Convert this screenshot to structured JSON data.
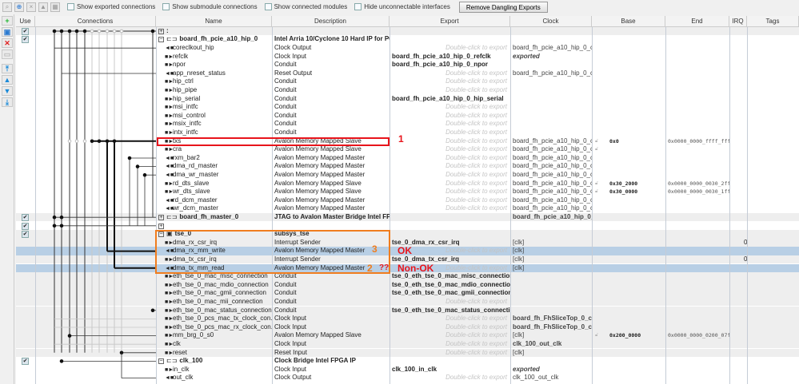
{
  "toolbar": {
    "checkboxes": [
      "Show exported connections",
      "Show submodule connections",
      "Show connected modules",
      "Hide unconnectable interfaces"
    ],
    "remove_button": "Remove Dangling Exports"
  },
  "columns": [
    "Use",
    "Connections",
    "Name",
    "Description",
    "Export",
    "Clock",
    "Base",
    "End",
    "IRQ",
    "Tags"
  ],
  "placeholder_export": "Double-click to export",
  "rows": [
    {
      "lvl": 0,
      "use": true,
      "exp": "plus",
      "name": ":",
      "desc": "",
      "export": "",
      "clock": "",
      "bg": "gray"
    },
    {
      "lvl": 0,
      "use": true,
      "exp": "minus",
      "icon": "module",
      "name": "board_fh_pcie_a10_hip_0",
      "desc": "Intel Arria 10/Cyclone 10 Hard IP for PCI E...",
      "export": "",
      "clock": ""
    },
    {
      "lvl": 1,
      "dir": "out",
      "name": "coreclkout_hip",
      "desc": "Clock Output",
      "export": "*",
      "clock": "board_fh_pcie_a10_hip_0_c..."
    },
    {
      "lvl": 1,
      "dir": "in",
      "name": "refclk",
      "desc": "Clock Input",
      "export": "board_fh_pcie_a10_hip_0_refclk",
      "clock": "exported",
      "clock_style": "ital"
    },
    {
      "lvl": 1,
      "dir": "in",
      "name": "npor",
      "desc": "Conduit",
      "export": "board_fh_pcie_a10_hip_0_npor",
      "clock": ""
    },
    {
      "lvl": 1,
      "dir": "out",
      "name": "app_nreset_status",
      "desc": "Reset Output",
      "export": "*",
      "clock": "board_fh_pcie_a10_hip_0_c..."
    },
    {
      "lvl": 1,
      "dir": "in",
      "name": "hip_ctrl",
      "desc": "Conduit",
      "export": "*",
      "clock": ""
    },
    {
      "lvl": 1,
      "dir": "in",
      "name": "hip_pipe",
      "desc": "Conduit",
      "export": "*",
      "clock": ""
    },
    {
      "lvl": 1,
      "dir": "in",
      "name": "hip_serial",
      "desc": "Conduit",
      "export": "board_fh_pcie_a10_hip_0_hip_serial",
      "clock": ""
    },
    {
      "lvl": 1,
      "dir": "in",
      "name": "msi_intfc",
      "desc": "Conduit",
      "export": "*",
      "clock": ""
    },
    {
      "lvl": 1,
      "dir": "in",
      "name": "msi_control",
      "desc": "Conduit",
      "export": "*",
      "clock": ""
    },
    {
      "lvl": 1,
      "dir": "in",
      "name": "msix_intfc",
      "desc": "Conduit",
      "export": "*",
      "clock": ""
    },
    {
      "lvl": 1,
      "dir": "in",
      "name": "intx_intfc",
      "desc": "Conduit",
      "export": "*",
      "clock": ""
    },
    {
      "lvl": 1,
      "dir": "in",
      "name": "txs",
      "desc": "Avalon Memory Mapped Slave",
      "export": "*",
      "clock": "board_fh_pcie_a10_hip_0_c...",
      "base": "0x0",
      "end": "0x0000_0000_ffff_ffff"
    },
    {
      "lvl": 1,
      "dir": "in",
      "name": "cra",
      "desc": "Avalon Memory Mapped Slave",
      "export": "*",
      "clock": "board_fh_pcie_a10_hip_0_c...",
      "base": ""
    },
    {
      "lvl": 1,
      "dir": "out",
      "name": "rxm_bar2",
      "desc": "Avalon Memory Mapped Master",
      "export": "*",
      "clock": "board_fh_pcie_a10_hip_0_c..."
    },
    {
      "lvl": 1,
      "dir": "out",
      "name": "dma_rd_master",
      "desc": "Avalon Memory Mapped Master",
      "export": "*",
      "clock": "board_fh_pcie_a10_hip_0_c..."
    },
    {
      "lvl": 1,
      "dir": "out",
      "name": "dma_wr_master",
      "desc": "Avalon Memory Mapped Master",
      "export": "*",
      "clock": "board_fh_pcie_a10_hip_0_c..."
    },
    {
      "lvl": 1,
      "dir": "in",
      "name": "rd_dts_slave",
      "desc": "Avalon Memory Mapped Slave",
      "export": "*",
      "clock": "board_fh_pcie_a10_hip_0_c...",
      "base": "0x30_2000",
      "end": "0x0000_0000_0030_2fff"
    },
    {
      "lvl": 1,
      "dir": "in",
      "name": "wr_dts_slave",
      "desc": "Avalon Memory Mapped Slave",
      "export": "*",
      "clock": "board_fh_pcie_a10_hip_0_c...",
      "base": "0x30_0000",
      "end": "0x0000_0000_0030_1fff"
    },
    {
      "lvl": 1,
      "dir": "out",
      "name": "rd_dcm_master",
      "desc": "Avalon Memory Mapped Master",
      "export": "*",
      "clock": "board_fh_pcie_a10_hip_0_c..."
    },
    {
      "lvl": 1,
      "dir": "out",
      "name": "wr_dcm_master",
      "desc": "Avalon Memory Mapped Master",
      "export": "*",
      "clock": "board_fh_pcie_a10_hip_0_c..."
    },
    {
      "lvl": 0,
      "use": true,
      "exp": "plus",
      "icon": "module",
      "name": "board_fh_master_0",
      "desc": "JTAG to Avalon Master Bridge Intel FPGA IP",
      "export": "",
      "clock": "board_fh_pcie_a10_hip_0_c...",
      "clock_style": "bold",
      "bg": "gray"
    },
    {
      "lvl": 0,
      "use": true,
      "exp": "plus",
      "name": "",
      "desc": "",
      "export": "",
      "clock": ""
    },
    {
      "lvl": 0,
      "use": true,
      "exp": "minus",
      "icon": "subsystem",
      "name": "tse_0",
      "desc": "subsys_tse",
      "export": "",
      "clock": "",
      "bg": "gray"
    },
    {
      "lvl": 1,
      "dir": "in",
      "name": "dma_rx_csr_irq",
      "desc": "Interrupt Sender",
      "export": "tse_0_dma_rx_csr_irq",
      "clock": "[clk]",
      "irq": "0",
      "bg": "gray"
    },
    {
      "lvl": 1,
      "dir": "out",
      "name": "dma_rx_mm_write",
      "desc": "Avalon Memory Mapped Master",
      "export": "*",
      "clock": "[clk]",
      "bg": "sel"
    },
    {
      "lvl": 1,
      "dir": "in",
      "name": "dma_tx_csr_irq",
      "desc": "Interrupt Sender",
      "export": "tse_0_dma_tx_csr_irq",
      "clock": "[clk]",
      "irq": "0",
      "bg": "gray"
    },
    {
      "lvl": 1,
      "dir": "out",
      "name": "dma_tx_mm_read",
      "desc": "Avalon Memory Mapped Master",
      "export": "*",
      "clock": "[clk]",
      "bg": "sel"
    },
    {
      "lvl": 1,
      "dir": "in",
      "name": "eth_tse_0_mac_misc_connection",
      "desc": "Conduit",
      "export": "tse_0_eth_tse_0_mac_misc_connection",
      "clock": "",
      "bg": "gray"
    },
    {
      "lvl": 1,
      "dir": "in",
      "name": "eth_tse_0_mac_mdio_connection",
      "desc": "Conduit",
      "export": "tse_0_eth_tse_0_mac_mdio_connection",
      "clock": "",
      "bg": "gray"
    },
    {
      "lvl": 1,
      "dir": "in",
      "name": "eth_tse_0_mac_gmii_connection",
      "desc": "Conduit",
      "export": "tse_0_eth_tse_0_mac_gmii_connection",
      "clock": "",
      "bg": "gray"
    },
    {
      "lvl": 1,
      "dir": "in",
      "name": "eth_tse_0_mac_mii_connection",
      "desc": "Conduit",
      "export": "*",
      "clock": "",
      "bg": "gray"
    },
    {
      "lvl": 1,
      "dir": "in",
      "name": "eth_tse_0_mac_status_connection",
      "desc": "Conduit",
      "export": "tse_0_eth_tse_0_mac_status_connection",
      "clock": "",
      "bg": "gray"
    },
    {
      "lvl": 1,
      "dir": "in",
      "name": "eth_tse_0_pcs_mac_tx_clock_con...",
      "desc": "Clock Input",
      "export": "*",
      "clock": "board_fh_FhSliceTop_0_clk25",
      "clock_style": "bold",
      "bg": "gray"
    },
    {
      "lvl": 1,
      "dir": "in",
      "name": "eth_tse_0_pcs_mac_rx_clock_con...",
      "desc": "Clock Input",
      "export": "*",
      "clock": "board_fh_FhSliceTop_0_clk25",
      "clock_style": "bold",
      "bg": "gray"
    },
    {
      "lvl": 1,
      "dir": "in",
      "name": "mm_brg_0_s0",
      "desc": "Avalon Memory Mapped Slave",
      "export": "*",
      "clock": "[clk]",
      "base": "0x200_0000",
      "end": "0x0000_0000_0200_07ff",
      "bg": "gray"
    },
    {
      "lvl": 1,
      "dir": "in",
      "name": "clk",
      "desc": "Clock Input",
      "export": "*",
      "clock": "clk_100_out_clk",
      "clock_style": "bold",
      "bg": "gray"
    },
    {
      "lvl": 1,
      "dir": "in",
      "name": "reset",
      "desc": "Reset Input",
      "export": "*",
      "clock": "[clk]",
      "bg": "gray"
    },
    {
      "lvl": 0,
      "use": true,
      "exp": "minus",
      "icon": "module",
      "name": "clk_100",
      "desc": "Clock Bridge Intel FPGA IP",
      "export": "",
      "clock": ""
    },
    {
      "lvl": 1,
      "dir": "in",
      "name": "in_clk",
      "desc": "Clock Input",
      "export": "clk_100_in_clk",
      "clock": "exported",
      "clock_style": "ital"
    },
    {
      "lvl": 1,
      "dir": "out",
      "name": "out_clk",
      "desc": "Clock Output",
      "export": "*",
      "clock": "clk_100_out_clk"
    }
  ],
  "annotations": {
    "n1": "1",
    "n2": "2",
    "n3": "3",
    "qq": "??",
    "ok": "OK",
    "nok": "Non-OK"
  },
  "colors": {
    "red": "#e8141b",
    "orange": "#f07d1e",
    "selected": "#b8cfe5",
    "gray": "#eeeeee"
  }
}
